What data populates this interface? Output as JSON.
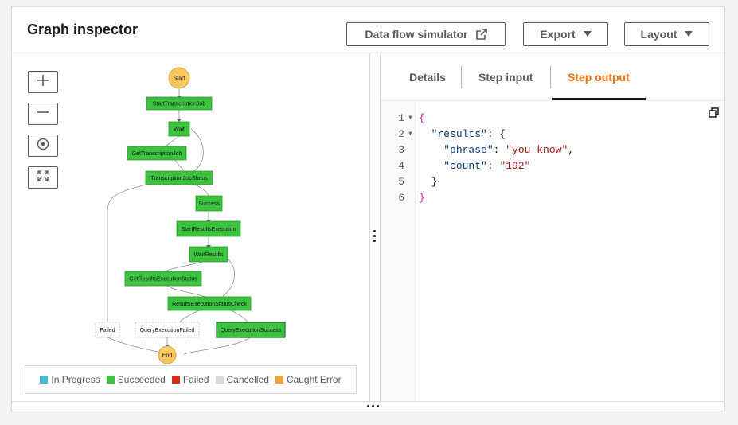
{
  "header": {
    "title": "Graph inspector",
    "buttons": {
      "simulator": "Data flow simulator",
      "export": "Export",
      "layout": "Layout"
    }
  },
  "graph": {
    "states": {
      "start": "Start",
      "start_transcription": "StartTranscriptionJob",
      "wait": "Wait",
      "get_transcription": "GetTranscriptionJob",
      "transcription_status": "TranscriptionJobStatus",
      "success": "Success",
      "start_results": "StartResultsExecution",
      "wait_results": "WaitResults",
      "get_results_status": "GetResultsExecutionStatus",
      "results_status_check": "ResultsExecutionStatusCheck",
      "failed": "Failed",
      "query_failed": "QueryExecutionFailed",
      "query_success": "QueryExecutionSuccess",
      "end": "End"
    },
    "legend": {
      "in_progress": "In Progress",
      "succeeded": "Succeeded",
      "failed": "Failed",
      "cancelled": "Cancelled",
      "caught_error": "Caught Error"
    },
    "colors": {
      "in_progress": "#44b9d6",
      "succeeded": "#3dc23f",
      "failed": "#d13212",
      "cancelled": "#d5dbdb",
      "caught_error": "#f2a23c"
    }
  },
  "tabs": {
    "details": "Details",
    "step_input": "Step input",
    "step_output": "Step output",
    "active": "step_output"
  },
  "code": {
    "lines": [
      {
        "n": "1",
        "fold": "▼",
        "parts": [
          {
            "t": "{",
            "c": "brace"
          }
        ]
      },
      {
        "n": "2",
        "fold": "▼",
        "parts": [
          {
            "t": "  ",
            "c": ""
          },
          {
            "t": "\"results\"",
            "c": "key"
          },
          {
            "t": ": {",
            "c": ""
          }
        ]
      },
      {
        "n": "3",
        "fold": "",
        "parts": [
          {
            "t": "    ",
            "c": ""
          },
          {
            "t": "\"phrase\"",
            "c": "key"
          },
          {
            "t": ": ",
            "c": ""
          },
          {
            "t": "\"you know\"",
            "c": "str"
          },
          {
            "t": ",",
            "c": ""
          }
        ]
      },
      {
        "n": "4",
        "fold": "",
        "parts": [
          {
            "t": "    ",
            "c": ""
          },
          {
            "t": "\"count\"",
            "c": "key"
          },
          {
            "t": ": ",
            "c": ""
          },
          {
            "t": "\"192\"",
            "c": "str"
          }
        ]
      },
      {
        "n": "5",
        "fold": "",
        "parts": [
          {
            "t": "  }",
            "c": ""
          }
        ]
      },
      {
        "n": "6",
        "fold": "",
        "parts": [
          {
            "t": "}",
            "c": "brace"
          }
        ]
      }
    ]
  }
}
